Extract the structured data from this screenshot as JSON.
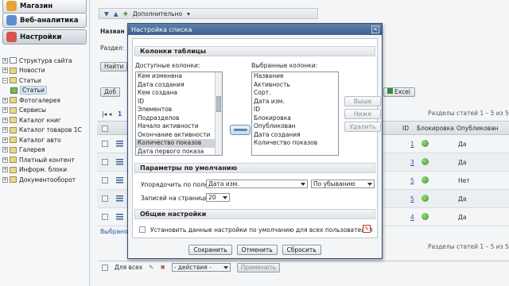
{
  "sidebar": {
    "modules": [
      {
        "label": "Магазин",
        "color": "#e7a43a"
      },
      {
        "label": "Веб-аналитика",
        "color": "#5c8ed1"
      },
      {
        "label": "Настройки",
        "color": "#d9534f"
      }
    ],
    "tree": [
      {
        "label": "Структура сайта",
        "exp": "+"
      },
      {
        "label": "Новости",
        "exp": "+"
      },
      {
        "label": "Статьи",
        "exp": "−"
      },
      {
        "label": "Статьи",
        "exp": ""
      },
      {
        "label": "Фотогалерея",
        "exp": "+"
      },
      {
        "label": "Сервисы",
        "exp": "+"
      },
      {
        "label": "Каталог книг",
        "exp": "+"
      },
      {
        "label": "Каталог товаров 1С",
        "exp": "+"
      },
      {
        "label": "Каталог авто",
        "exp": "+"
      },
      {
        "label": "Галерея",
        "exp": "+"
      },
      {
        "label": "Платный контент",
        "exp": "+"
      },
      {
        "label": "Информ. блоки",
        "exp": "+"
      },
      {
        "label": "Документооборот",
        "exp": "+"
      }
    ]
  },
  "main": {
    "toolbar_label": "Дополнительно",
    "name_label": "Назван",
    "section_label": "Раздел:",
    "find_button": "Найти",
    "add_button": "Доб",
    "excel_label": "Excel",
    "pager_text": "Разделы статей 1 – 5 из 5",
    "page_num": "1",
    "columns": {
      "id": "ID",
      "lock": "Блокировка",
      "published": "Опубликован"
    },
    "rows": [
      {
        "id": "1",
        "published": "Да"
      },
      {
        "id": "3",
        "published": "Да"
      },
      {
        "id": "5",
        "published": "Нет"
      },
      {
        "id": "5",
        "published": "Да"
      },
      {
        "id": "4",
        "published": "Да"
      }
    ],
    "selected_label": "Выбрано",
    "for_all_label": "Для всех",
    "actions_select": "- действия -",
    "apply_button": "Применить"
  },
  "dialog": {
    "title": "Настройка списка",
    "sections": {
      "columns": "Колонки таблицы",
      "defaults": "Параметры по умолчанию",
      "general": "Общие настройки"
    },
    "available_label": "Доступные колонки:",
    "selected_label": "Выбранные колонки:",
    "available": [
      "Кем изменена",
      "Дата создания",
      "Кем создана",
      "ID",
      "Элементов",
      "Подразделов",
      "Начало активности",
      "Окончание активности",
      "Количество показов",
      "Дата первого показа"
    ],
    "available_selected_index": 8,
    "selected": [
      "Название",
      "Активность",
      "Сорт.",
      "Дата изм.",
      "ID",
      "Блокировка",
      "Опубликован",
      "Дата создания",
      "Количество показов"
    ],
    "buttons": {
      "up": "Выше",
      "down": "Ниже",
      "remove": "Удалить"
    },
    "sort_label": "Упорядочить по полю:",
    "sort_field": "Дата изм.",
    "sort_order": "По убыванию",
    "per_page_label": "Записей на странице:",
    "per_page": "20",
    "apply_all_label": "Установить данные настройки по умолчанию для всех пользователей",
    "footer": {
      "save": "Сохранить",
      "cancel": "Отменить",
      "reset": "Сбросить"
    }
  }
}
